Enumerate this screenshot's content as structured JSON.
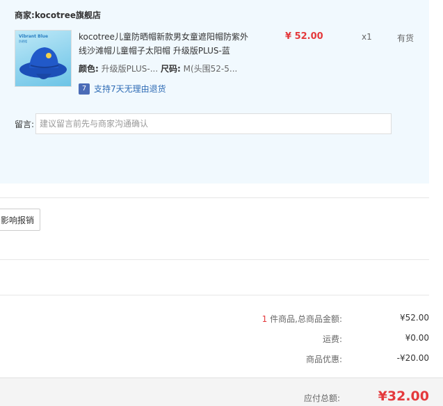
{
  "order": {
    "merchant_prefix": "商家:",
    "merchant_name": "kocotree旗舰店",
    "thumb_brand": "Vibrant Blue",
    "thumb_sub": "防晒帽",
    "item_title": "kocotree儿童防晒帽新款男女童遮阳帽防紫外线沙滩帽儿童帽子太阳帽 升级版PLUS-蓝",
    "color_label": "颜色:",
    "color_value": "升级版PLUS-...",
    "size_label": "尺码:",
    "size_value": "M(头围52-5...",
    "return_badge": "7",
    "return_text": "支持7天无理由退货",
    "price": "¥ 52.00",
    "quantity": "x1",
    "stock": "有货"
  },
  "message": {
    "label": "留言:",
    "placeholder": "建议留言前先与商家沟通确认"
  },
  "report_button": "影响报销",
  "summary": {
    "item_count": "1",
    "item_count_suffix": " 件商品,总商品金额:",
    "items_total": "¥52.00",
    "shipping_label": "运费:",
    "shipping_value": "¥0.00",
    "discount_label": "商品优惠:",
    "discount_value": "-¥20.00",
    "pay_label": "应付总额:",
    "pay_value": "¥32.00"
  }
}
